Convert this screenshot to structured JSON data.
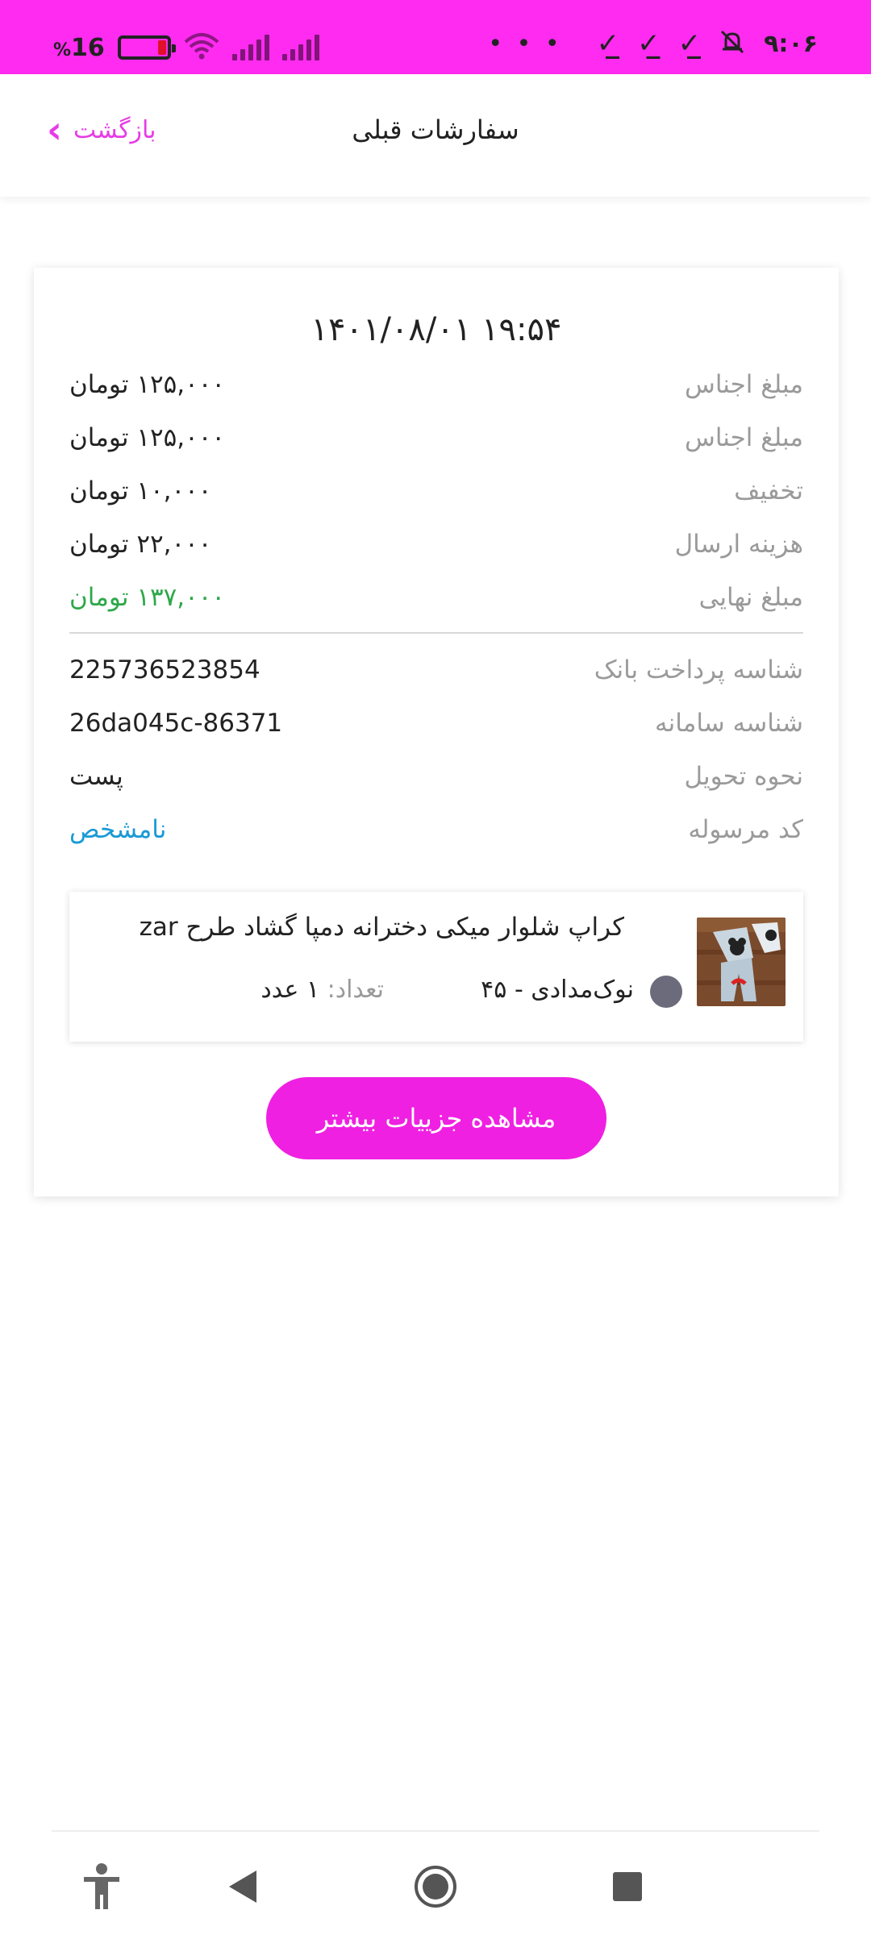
{
  "status_bar": {
    "battery_percent": "16",
    "percent_sign": "%",
    "time": "۹:۰۶",
    "overflow": "• • •"
  },
  "app_bar": {
    "title": "سفارشات قبلی",
    "back_label": "بازگشت",
    "accent_color": "#e63ce6"
  },
  "order": {
    "datetime": "۱۴۰۱/۰۸/۰۱ ۱۹:۵۴",
    "rows": [
      {
        "label": "مبلغ اجناس",
        "value": "۱۲۵,۰۰۰ تومان"
      },
      {
        "label": "مبلغ اجناس",
        "value": "۱۲۵,۰۰۰ تومان"
      },
      {
        "label": "تخفیف",
        "value": "۱۰,۰۰۰ تومان"
      },
      {
        "label": "هزینه ارسال",
        "value": "۲۲,۰۰۰ تومان"
      },
      {
        "label": "مبلغ نهایی",
        "value": "۱۳۷,۰۰۰ تومان"
      }
    ],
    "details": [
      {
        "label": "شناسه پرداخت بانک",
        "value": "225736523854"
      },
      {
        "label": "شناسه سامانه",
        "value": "26da045c-86371"
      },
      {
        "label": "نحوه تحویل",
        "value": "پست"
      },
      {
        "label": "کد مرسوله",
        "value": "نامشخص"
      }
    ],
    "final_color": "#2ea84a",
    "tracking_color": "#1a9ad6"
  },
  "item": {
    "title": "کراپ شلوار میکی دخترانه دمپا گشاد طرح zar",
    "variant": "نوک‌مدادی  -  ۴۵",
    "swatch_color": "#6b6b7b",
    "qty_label": "تعداد:",
    "qty_value": " ۱ عدد"
  },
  "more_button": {
    "label": "مشاهده جزییات بیشتر",
    "color": "#ef20e2"
  },
  "nav": {
    "icons": [
      "accessibility-icon",
      "back-triangle-icon",
      "home-circle-icon",
      "recents-square-icon"
    ]
  }
}
